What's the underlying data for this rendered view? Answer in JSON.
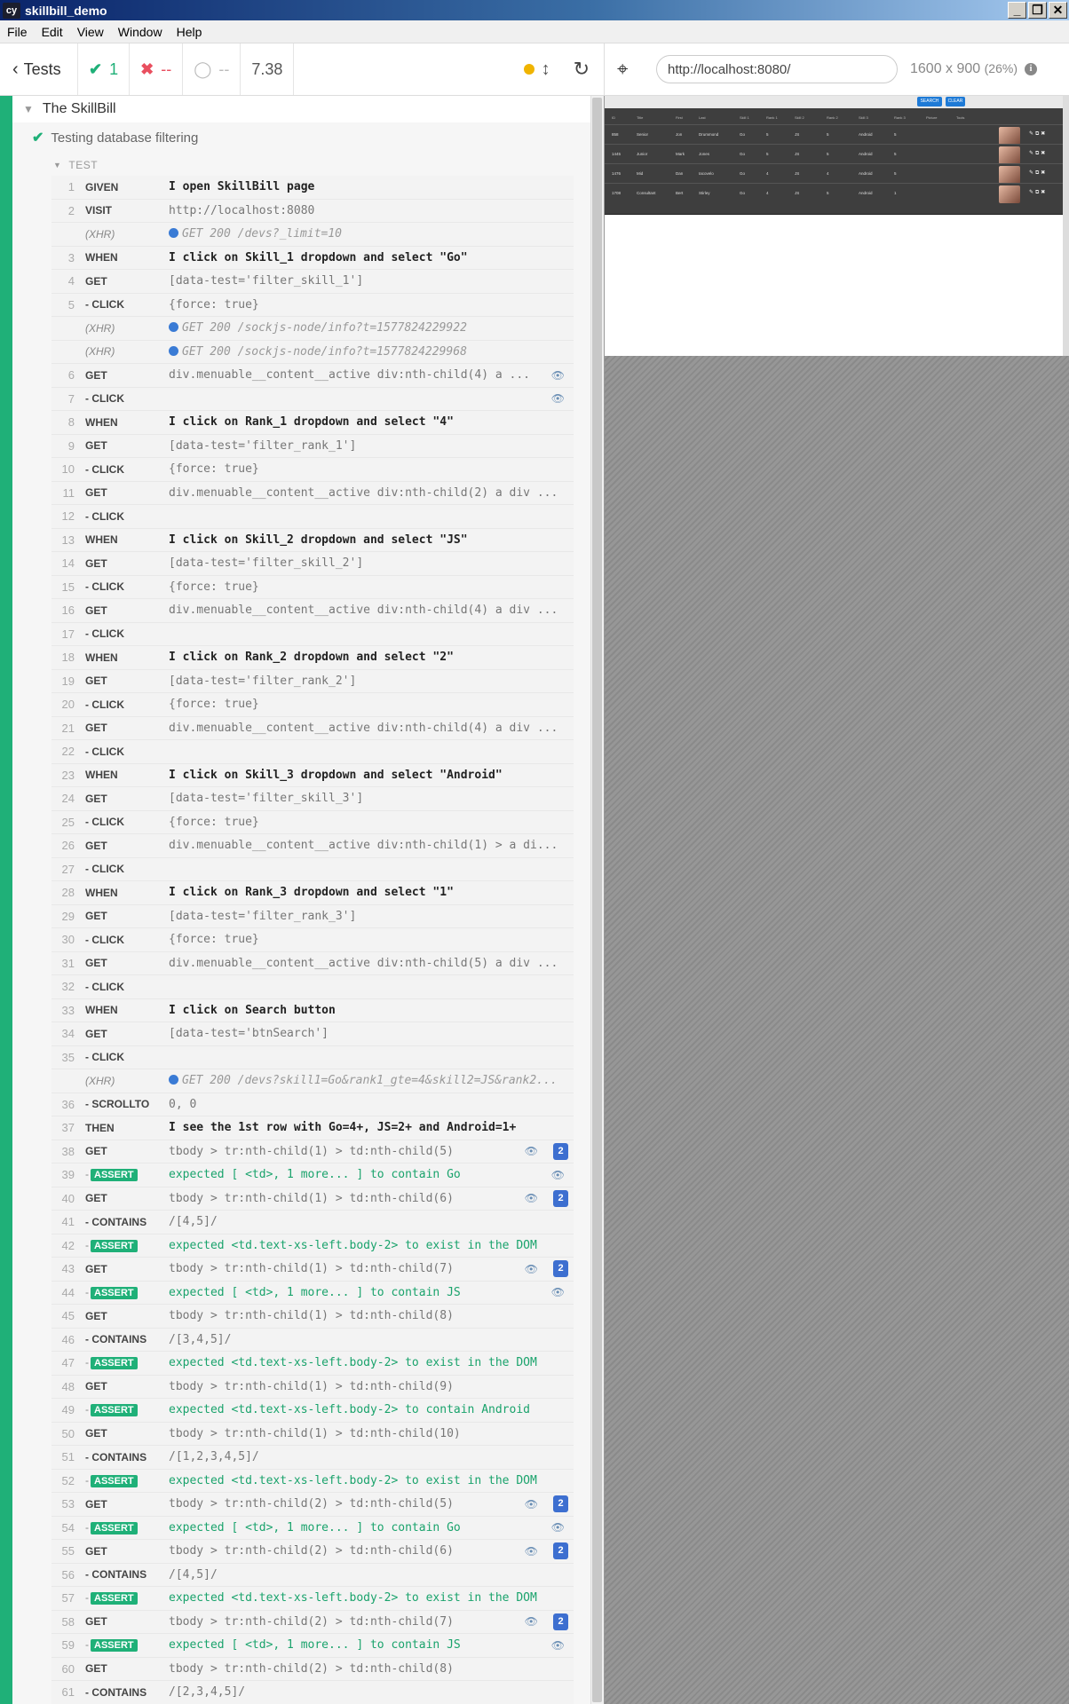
{
  "window": {
    "title": "skillbill_demo",
    "icon_text": "cy",
    "controls": [
      "_",
      "❐",
      "✕"
    ]
  },
  "menu": [
    "File",
    "Edit",
    "View",
    "Window",
    "Help"
  ],
  "toolbar": {
    "tests_label": "Tests",
    "passed": "1",
    "failed": "--",
    "pending": "--",
    "duration": "7.38"
  },
  "aut": {
    "url": "http://localhost:8080/",
    "viewport": "1600 x 900",
    "scale": "(26%)",
    "preview_buttons": [
      "SEARCH",
      "CLEAR"
    ],
    "preview_headers": [
      "ID",
      "Title",
      "First",
      "Last",
      "Skill 1",
      "Rank 1",
      "Skill 2",
      "Rank 2",
      "Skill 3",
      "Rank 3",
      "Picture",
      "Tools"
    ],
    "preview_rows": [
      [
        "858",
        "Senior",
        "Jon",
        "Drummond",
        "Go",
        "5",
        "JS",
        "5",
        "Android",
        "5"
      ],
      [
        "1445",
        "Junior",
        "Mark",
        "Jones",
        "Go",
        "5",
        "JS",
        "5",
        "Android",
        "5"
      ],
      [
        "1476",
        "Mid",
        "Dan",
        "Iacovelo",
        "Go",
        "4",
        "JS",
        "4",
        "Android",
        "5"
      ],
      [
        "1708",
        "Consultant",
        "Bert",
        "Stirley",
        "Go",
        "4",
        "JS",
        "5",
        "Android",
        "1"
      ]
    ]
  },
  "reporter": {
    "suite": "The SkillBill",
    "test": "Testing database filtering",
    "test_header": "TEST",
    "commands": [
      {
        "num": "1",
        "name": "GIVEN",
        "msg": "I open SkillBill page",
        "style": "bold"
      },
      {
        "num": "2",
        "name": "VISIT",
        "msg": "http://localhost:8080",
        "style": ""
      },
      {
        "num": "",
        "name": "(XHR)",
        "msg": "GET 200 /devs?_limit=10",
        "style": "xhr"
      },
      {
        "num": "3",
        "name": "WHEN",
        "msg": "I click on Skill_1 dropdown and select \"Go\"",
        "style": "bold"
      },
      {
        "num": "4",
        "name": "GET",
        "msg": "[data-test='filter_skill_1']",
        "style": ""
      },
      {
        "num": "5",
        "name": "- CLICK",
        "msg": "{force: true}",
        "style": ""
      },
      {
        "num": "",
        "name": "(XHR)",
        "msg": "GET 200 /sockjs-node/info?t=1577824229922",
        "style": "xhr"
      },
      {
        "num": "",
        "name": "(XHR)",
        "msg": "GET 200 /sockjs-node/info?t=1577824229968",
        "style": "xhr"
      },
      {
        "num": "6",
        "name": "GET",
        "msg": "div.menuable__content__active div:nth-child(4) a ...",
        "style": "",
        "eye": true
      },
      {
        "num": "7",
        "name": "- CLICK",
        "msg": "",
        "style": "",
        "eye": true
      },
      {
        "num": "8",
        "name": "WHEN",
        "msg": "I click on Rank_1 dropdown and select \"4\"",
        "style": "bold"
      },
      {
        "num": "9",
        "name": "GET",
        "msg": "[data-test='filter_rank_1']",
        "style": ""
      },
      {
        "num": "10",
        "name": "- CLICK",
        "msg": "{force: true}",
        "style": ""
      },
      {
        "num": "11",
        "name": "GET",
        "msg": "div.menuable__content__active div:nth-child(2) a div ...",
        "style": ""
      },
      {
        "num": "12",
        "name": "- CLICK",
        "msg": "",
        "style": ""
      },
      {
        "num": "13",
        "name": "WHEN",
        "msg": "I click on Skill_2 dropdown and select \"JS\"",
        "style": "bold"
      },
      {
        "num": "14",
        "name": "GET",
        "msg": "[data-test='filter_skill_2']",
        "style": ""
      },
      {
        "num": "15",
        "name": "- CLICK",
        "msg": "{force: true}",
        "style": ""
      },
      {
        "num": "16",
        "name": "GET",
        "msg": "div.menuable__content__active div:nth-child(4) a div ...",
        "style": ""
      },
      {
        "num": "17",
        "name": "- CLICK",
        "msg": "",
        "style": ""
      },
      {
        "num": "18",
        "name": "WHEN",
        "msg": "I click on Rank_2 dropdown and select \"2\"",
        "style": "bold"
      },
      {
        "num": "19",
        "name": "GET",
        "msg": "[data-test='filter_rank_2']",
        "style": ""
      },
      {
        "num": "20",
        "name": "- CLICK",
        "msg": "{force: true}",
        "style": ""
      },
      {
        "num": "21",
        "name": "GET",
        "msg": "div.menuable__content__active div:nth-child(4) a div ...",
        "style": ""
      },
      {
        "num": "22",
        "name": "- CLICK",
        "msg": "",
        "style": ""
      },
      {
        "num": "23",
        "name": "WHEN",
        "msg": "I click on Skill_3 dropdown and select \"Android\"",
        "style": "bold"
      },
      {
        "num": "24",
        "name": "GET",
        "msg": "[data-test='filter_skill_3']",
        "style": ""
      },
      {
        "num": "25",
        "name": "- CLICK",
        "msg": "{force: true}",
        "style": ""
      },
      {
        "num": "26",
        "name": "GET",
        "msg": "div.menuable__content__active div:nth-child(1) > a di...",
        "style": ""
      },
      {
        "num": "27",
        "name": "- CLICK",
        "msg": "",
        "style": ""
      },
      {
        "num": "28",
        "name": "WHEN",
        "msg": "I click on Rank_3 dropdown and select \"1\"",
        "style": "bold"
      },
      {
        "num": "29",
        "name": "GET",
        "msg": "[data-test='filter_rank_3']",
        "style": ""
      },
      {
        "num": "30",
        "name": "- CLICK",
        "msg": "{force: true}",
        "style": ""
      },
      {
        "num": "31",
        "name": "GET",
        "msg": "div.menuable__content__active div:nth-child(5) a div ...",
        "style": ""
      },
      {
        "num": "32",
        "name": "- CLICK",
        "msg": "",
        "style": ""
      },
      {
        "num": "33",
        "name": "WHEN",
        "msg": "I click on Search button",
        "style": "bold"
      },
      {
        "num": "34",
        "name": "GET",
        "msg": "[data-test='btnSearch']",
        "style": ""
      },
      {
        "num": "35",
        "name": "- CLICK",
        "msg": "",
        "style": ""
      },
      {
        "num": "",
        "name": "(XHR)",
        "msg": "GET 200 /devs?skill1=Go&rank1_gte=4&skill2=JS&rank2...",
        "style": "xhr"
      },
      {
        "num": "36",
        "name": "- SCROLLTO",
        "msg": "0, 0",
        "style": ""
      },
      {
        "num": "37",
        "name": "THEN",
        "msg": "I see the 1st row with Go=4+, JS=2+ and Android=1+",
        "style": "bold"
      },
      {
        "num": "38",
        "name": "GET",
        "msg": "tbody > tr:nth-child(1) > td:nth-child(5)",
        "style": "",
        "eye": true,
        "count": "2"
      },
      {
        "num": "39",
        "name": "ASSERT",
        "msg": "expected [ <td>, 1 more... ] to contain Go",
        "style": "assert",
        "eye": true
      },
      {
        "num": "40",
        "name": "GET",
        "msg": "tbody > tr:nth-child(1) > td:nth-child(6)",
        "style": "",
        "eye": true,
        "count": "2"
      },
      {
        "num": "41",
        "name": "- CONTAINS",
        "msg": "/[4,5]/",
        "style": ""
      },
      {
        "num": "42",
        "name": "ASSERT",
        "msg": "expected <td.text-xs-left.body-2> to exist in the DOM",
        "style": "assert"
      },
      {
        "num": "43",
        "name": "GET",
        "msg": "tbody > tr:nth-child(1) > td:nth-child(7)",
        "style": "",
        "eye": true,
        "count": "2"
      },
      {
        "num": "44",
        "name": "ASSERT",
        "msg": "expected [ <td>, 1 more... ] to contain JS",
        "style": "assert",
        "eye": true
      },
      {
        "num": "45",
        "name": "GET",
        "msg": "tbody > tr:nth-child(1) > td:nth-child(8)",
        "style": ""
      },
      {
        "num": "46",
        "name": "- CONTAINS",
        "msg": "/[3,4,5]/",
        "style": ""
      },
      {
        "num": "47",
        "name": "ASSERT",
        "msg": "expected <td.text-xs-left.body-2> to exist in the DOM",
        "style": "assert"
      },
      {
        "num": "48",
        "name": "GET",
        "msg": "tbody > tr:nth-child(1) > td:nth-child(9)",
        "style": ""
      },
      {
        "num": "49",
        "name": "ASSERT",
        "msg": "expected <td.text-xs-left.body-2> to contain Android",
        "style": "assert"
      },
      {
        "num": "50",
        "name": "GET",
        "msg": "tbody > tr:nth-child(1) > td:nth-child(10)",
        "style": ""
      },
      {
        "num": "51",
        "name": "- CONTAINS",
        "msg": "/[1,2,3,4,5]/",
        "style": ""
      },
      {
        "num": "52",
        "name": "ASSERT",
        "msg": "expected <td.text-xs-left.body-2> to exist in the DOM",
        "style": "assert"
      },
      {
        "num": "53",
        "name": "GET",
        "msg": "tbody > tr:nth-child(2) > td:nth-child(5)",
        "style": "",
        "eye": true,
        "count": "2"
      },
      {
        "num": "54",
        "name": "ASSERT",
        "msg": "expected [ <td>, 1 more... ] to contain Go",
        "style": "assert",
        "eye": true
      },
      {
        "num": "55",
        "name": "GET",
        "msg": "tbody > tr:nth-child(2) > td:nth-child(6)",
        "style": "",
        "eye": true,
        "count": "2"
      },
      {
        "num": "56",
        "name": "- CONTAINS",
        "msg": "/[4,5]/",
        "style": ""
      },
      {
        "num": "57",
        "name": "ASSERT",
        "msg": "expected <td.text-xs-left.body-2> to exist in the DOM",
        "style": "assert"
      },
      {
        "num": "58",
        "name": "GET",
        "msg": "tbody > tr:nth-child(2) > td:nth-child(7)",
        "style": "",
        "eye": true,
        "count": "2"
      },
      {
        "num": "59",
        "name": "ASSERT",
        "msg": "expected [ <td>, 1 more... ] to contain JS",
        "style": "assert",
        "eye": true
      },
      {
        "num": "60",
        "name": "GET",
        "msg": "tbody > tr:nth-child(2) > td:nth-child(8)",
        "style": ""
      },
      {
        "num": "61",
        "name": "- CONTAINS",
        "msg": "/[2,3,4,5]/",
        "style": ""
      }
    ]
  }
}
